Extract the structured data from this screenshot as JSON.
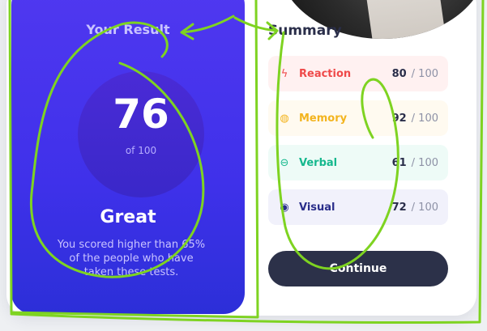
{
  "result": {
    "title": "Your Result",
    "score": "76",
    "out_of": "of 100",
    "verdict": "Great",
    "description": "You scored higher than 65% of the people who have taken these tests."
  },
  "summary": {
    "title": "Summary",
    "items": [
      {
        "label": "Reaction",
        "score": "80",
        "max": "/ 100",
        "icon": "lightning-icon",
        "color": "#ef4a4a",
        "bg": "#fff1f1"
      },
      {
        "label": "Memory",
        "score": "92",
        "max": "/ 100",
        "icon": "bulb-icon",
        "color": "#f3b41e",
        "bg": "#fffaf0"
      },
      {
        "label": "Verbal",
        "score": "61",
        "max": "/ 100",
        "icon": "chat-icon",
        "color": "#16b88e",
        "bg": "#eefbf7"
      },
      {
        "label": "Visual",
        "score": "72",
        "max": "/ 100",
        "icon": "eye-icon",
        "color": "#2a2e8a",
        "bg": "#f1f1fb"
      }
    ]
  },
  "continue_label": "Continue",
  "colors": {
    "accent": "#4a36ee",
    "button": "#2c3149",
    "annotation": "#7ed321"
  }
}
